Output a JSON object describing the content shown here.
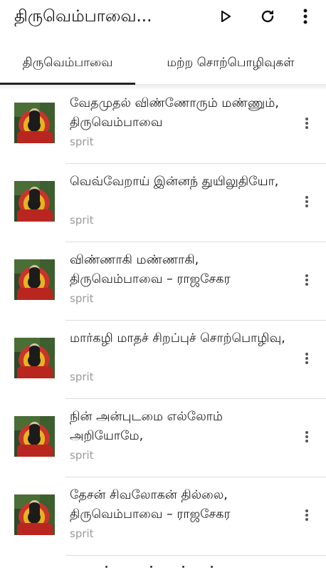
{
  "app_bar": {
    "title": "திருவெம்பாவை...",
    "icons": [
      "play-icon",
      "refresh-icon",
      "more-vert-icon"
    ]
  },
  "tabs": [
    {
      "label": "திருவெம்பாவை",
      "active": true
    },
    {
      "label": "மற்ற சொற்பொழிவுகள்",
      "active": false
    }
  ],
  "items": [
    {
      "title": "வேதமுதல் விண்ணோரும் மண்ணும், திருவெம்பாவை",
      "subtitle": "sprit"
    },
    {
      "title": "வெவ்வேறாய் இன்னந் துயிலுதியோ,",
      "subtitle": "sprit"
    },
    {
      "title": "விண்ணாகி மண்ணாகி, திருவெம்பாவை – ராஜசேகர",
      "subtitle": "sprit"
    },
    {
      "title": "மார்கழி மாதச் சிறப்புச் சொற்பொழிவு,",
      "subtitle": "sprit"
    },
    {
      "title": "நின் அன்புடமை எல்லோம் அறியோமே,",
      "subtitle": "sprit"
    },
    {
      "title": "தேசன் சிவலோகன் தில்லை, திருவெம்பாவை – ராஜசேகர",
      "subtitle": "sprit"
    }
  ],
  "colors": {
    "accent": "#222222",
    "subtitle": "#9a9a9a",
    "divider": "#dcdcdc"
  }
}
